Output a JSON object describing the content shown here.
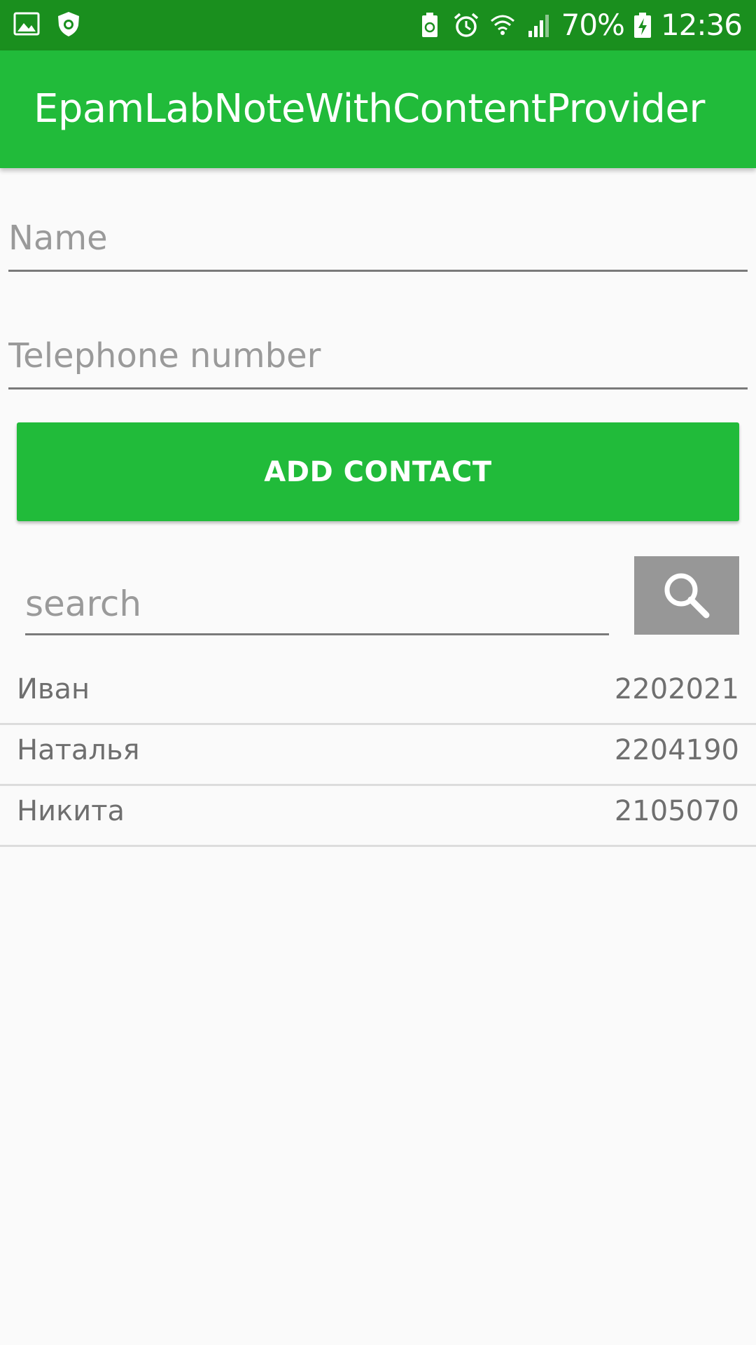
{
  "status_bar": {
    "battery": "70%",
    "time": "12:36",
    "left_icons": [
      "image-icon",
      "shield-bug-icon"
    ],
    "right_icons": [
      "battery-saver-icon",
      "alarm-icon",
      "wifi-icon",
      "signal-icon",
      "battery-charging-icon"
    ]
  },
  "app_bar": {
    "title": "EpamLabNoteWithContentProvider"
  },
  "form": {
    "name_placeholder": "Name",
    "name_value": "",
    "phone_placeholder": "Telephone number",
    "phone_value": "",
    "add_button_label": "ADD CONTACT"
  },
  "search": {
    "placeholder": "search",
    "value": "",
    "button_icon": "search-icon"
  },
  "contacts": [
    {
      "name": "Иван",
      "phone": "2202021"
    },
    {
      "name": "Наталья",
      "phone": "2204190"
    },
    {
      "name": "Никита",
      "phone": "2105070"
    }
  ],
  "colors": {
    "status_bar": "#1a8f1e",
    "primary": "#21bb3a",
    "search_button": "#979797",
    "background": "#fafafa"
  }
}
